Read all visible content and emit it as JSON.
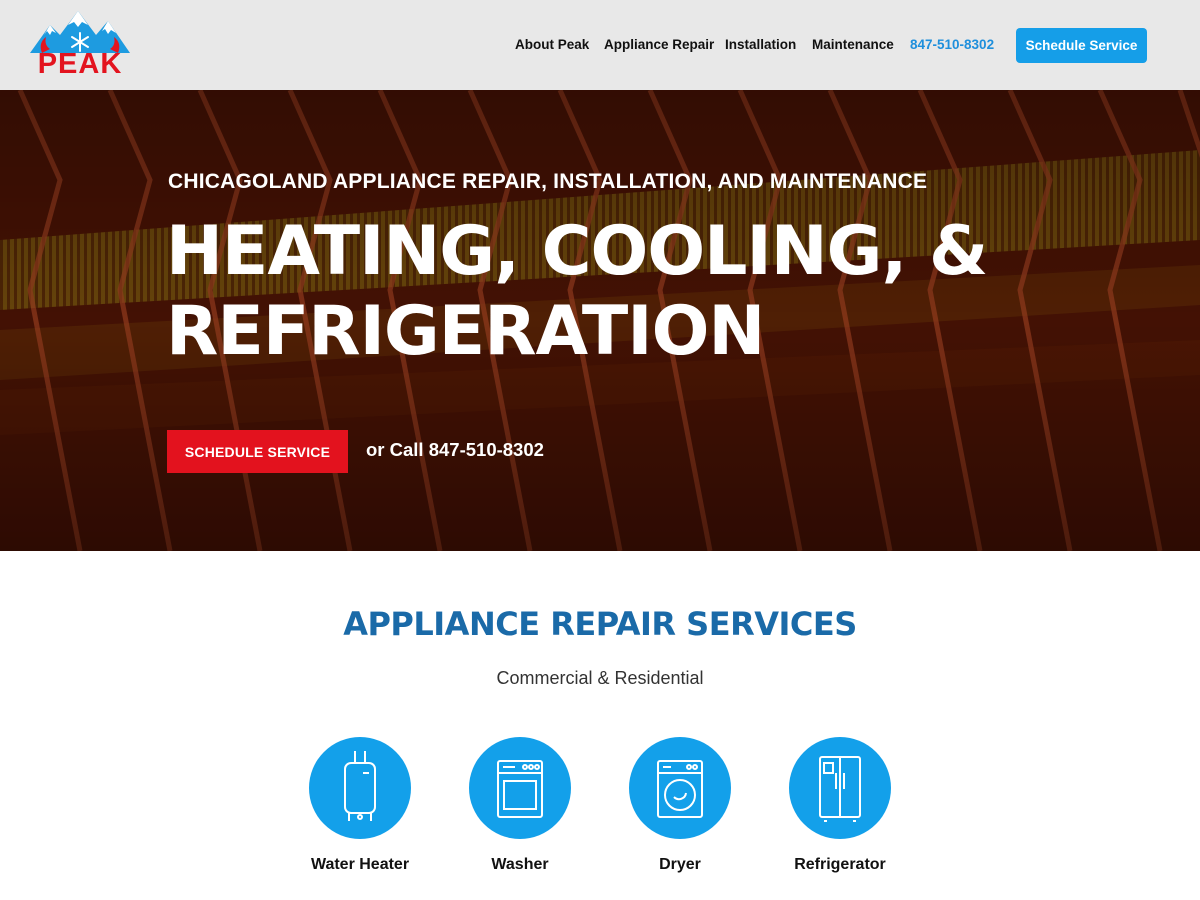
{
  "header": {
    "logo_text": "PEAK",
    "nav": [
      {
        "label": "About Peak"
      },
      {
        "label": "Appliance Repair"
      },
      {
        "label": "Installation"
      },
      {
        "label": "Maintenance"
      }
    ],
    "phone": "847-510-8302",
    "cta": "Schedule Service"
  },
  "hero": {
    "kicker": "CHICAGOLAND APPLIANCE REPAIR, INSTALLATION, AND MAINTENANCE",
    "title_line1": "HEATING, COOLING, &",
    "title_line2": "REFRIGERATION",
    "button": "SCHEDULE SERVICE",
    "call_text": "or Call 847-510-8302"
  },
  "services": {
    "title": "APPLIANCE REPAIR SERVICES",
    "subtitle": "Commercial & Residential",
    "items": [
      {
        "label": "Water Heater",
        "icon": "water-heater-icon"
      },
      {
        "label": "Washer",
        "icon": "washer-icon"
      },
      {
        "label": "Dryer",
        "icon": "dryer-icon"
      },
      {
        "label": "Refrigerator",
        "icon": "refrigerator-icon"
      }
    ]
  },
  "colors": {
    "brand_red": "#e3141f",
    "brand_blue": "#159ee8",
    "heading_blue": "#1a6aa8",
    "header_bg": "#e8e8e8"
  }
}
